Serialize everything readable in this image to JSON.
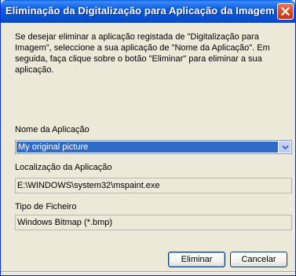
{
  "window": {
    "title": "Eliminação da Digitalização para Aplicação da Imagem"
  },
  "intro_text": "Se desejar eliminar a aplicação registada de \"Digitalização para Imagem\", seleccione a sua aplicação de \"Nome da Aplicação\". Em seguida, faça clique sobre o botão \"Eliminar\" para eliminar a sua aplicação.",
  "app_name": {
    "label": "Nome da Aplicação",
    "selected": "My original picture"
  },
  "app_location": {
    "label": "Localização da Aplicação",
    "value": "E:\\WINDOWS\\system32\\mspaint.exe"
  },
  "file_type": {
    "label": "Tipo de Ficheiro",
    "value": "Windows Bitmap (*.bmp)"
  },
  "buttons": {
    "delete": "Eliminar",
    "cancel": "Cancelar"
  },
  "icons": {
    "close": "close-icon",
    "dropdown": "chevron-down-icon"
  },
  "colors": {
    "titlebar": "#0552d6",
    "selection": "#316ac5",
    "close_button": "#d84a22",
    "dialog_bg": "#ece9d8"
  }
}
